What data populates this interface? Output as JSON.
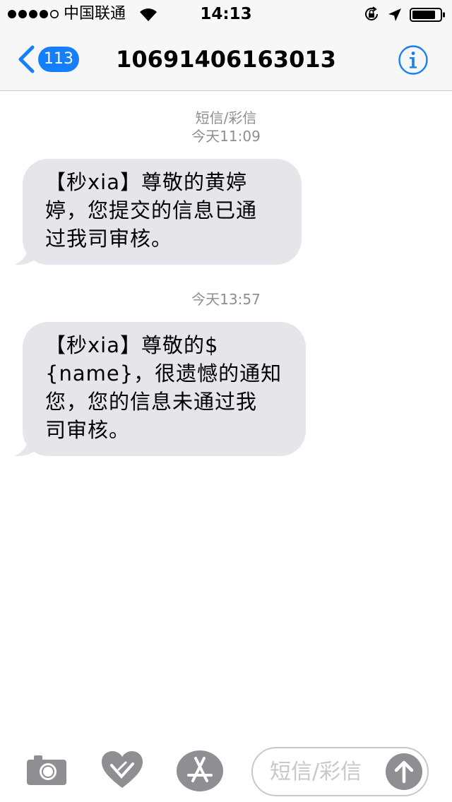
{
  "status_bar": {
    "carrier": "中国联通",
    "time": "14:13",
    "signal_bars": 4,
    "signal_total": 5
  },
  "nav": {
    "back_badge": "113",
    "title": "10691406163013",
    "accent": "#157efb"
  },
  "thread": {
    "service_label": "短信/彩信",
    "messages": [
      {
        "timestamp": "今天11:09",
        "text": "【秒xia】尊敬的黄婷\n婷，您提交的信息已通\n过我司审核。"
      },
      {
        "timestamp": "今天13:57",
        "text": "【秒xia】尊敬的$\n{name}，很遗憾的通知\n您，您的信息未通过我\n司审核。"
      }
    ]
  },
  "input_bar": {
    "placeholder": "短信/彩信",
    "icons": [
      "camera-icon",
      "digital-touch-icon",
      "app-store-icon",
      "send-arrow-icon"
    ]
  },
  "colors": {
    "bubble": "#e5e5ea",
    "meta_text": "#8e8e93",
    "bar_bg": "#f7f7f7"
  }
}
